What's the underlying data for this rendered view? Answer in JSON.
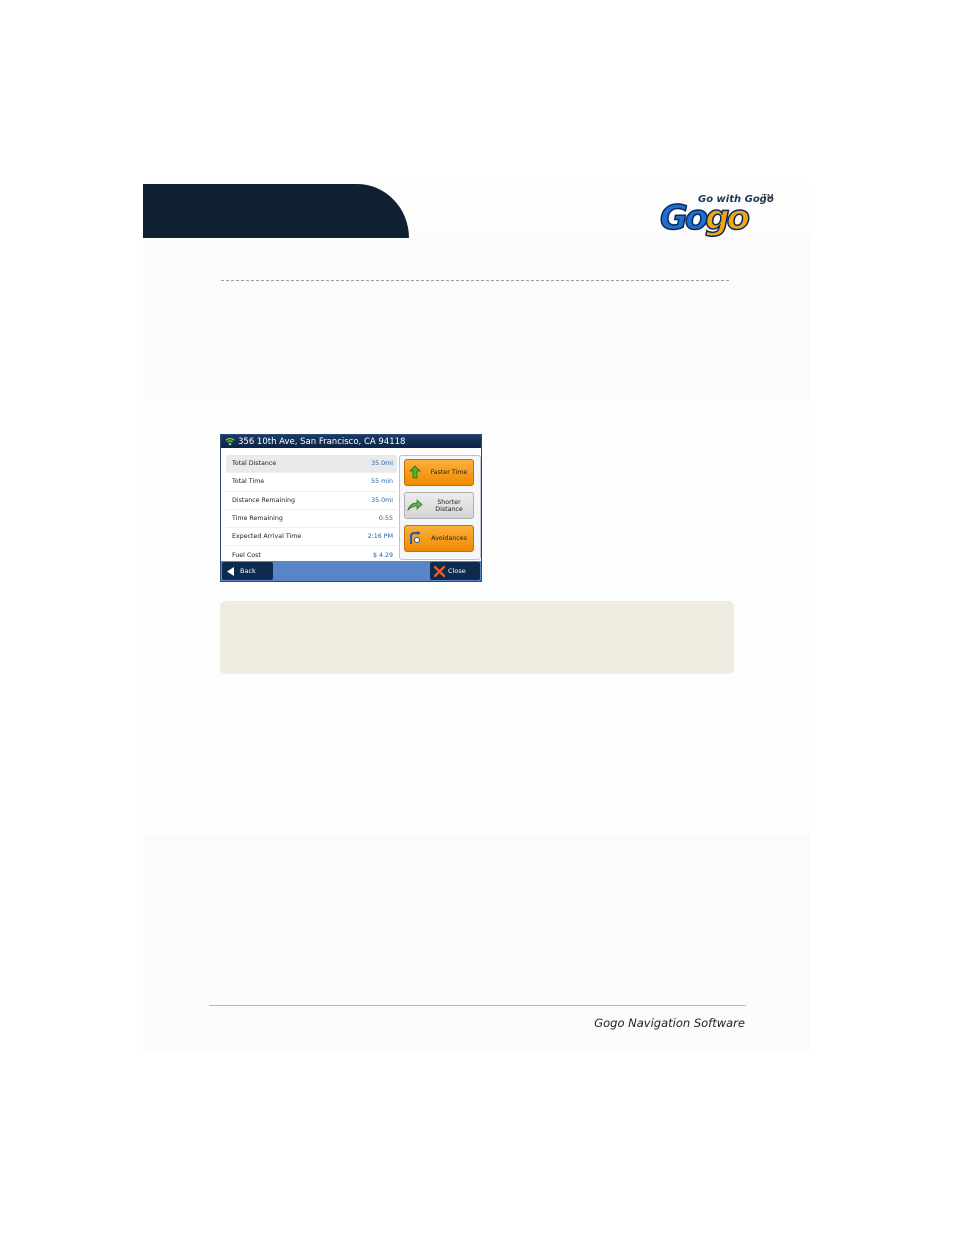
{
  "logo": {
    "tagline": "Go with Gogo",
    "tm": "TM",
    "wordmark_a": "Go",
    "wordmark_b": "go"
  },
  "device": {
    "address": "356 10th Ave, San Francisco, CA 94118",
    "rows": [
      {
        "label": "Total Distance",
        "value": "35.0mi"
      },
      {
        "label": "Total Time",
        "value": "55 min"
      },
      {
        "label": "Distance Remaining",
        "value": "35.0mi"
      },
      {
        "label": "Time Remaining",
        "value": "0:55"
      },
      {
        "label": "Expected Arrival Time",
        "value": "2:16 PM"
      },
      {
        "label": "Fuel Cost",
        "value": "$ 4.29"
      }
    ],
    "buttons": {
      "faster": "Faster Time",
      "shorter_1": "Shorter",
      "shorter_2": "Distance",
      "avoid": "Avoidances"
    },
    "footer": {
      "back": "Back",
      "close": "Close"
    }
  },
  "footer": {
    "text": "Gogo Navigation Software"
  },
  "colors": {
    "header": "#0f2133",
    "accent_orange": "#f08a00",
    "device_footer": "#5a84c8",
    "note_box": "#efebe0"
  }
}
